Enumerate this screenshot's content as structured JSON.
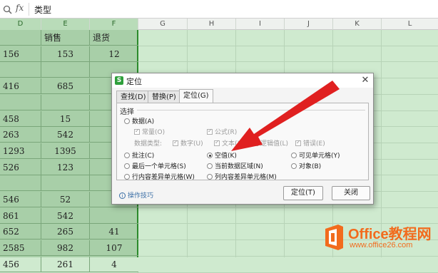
{
  "formula_bar": {
    "fx": "fx",
    "value": "类型"
  },
  "columns": [
    "D",
    "E",
    "F",
    "G",
    "H",
    "I",
    "J",
    "K",
    "L"
  ],
  "rows": [
    {
      "d": "",
      "e": "销售",
      "f": "退货",
      "header": true
    },
    {
      "d": "156",
      "e": "153",
      "f": "12"
    },
    {
      "d": "",
      "e": "",
      "f": ""
    },
    {
      "d": "416",
      "e": "685",
      "f": ""
    },
    {
      "d": "",
      "e": "",
      "f": ""
    },
    {
      "d": "458",
      "e": "15",
      "f": ""
    },
    {
      "d": "263",
      "e": "542",
      "f": ""
    },
    {
      "d": "1293",
      "e": "1395",
      "f": ""
    },
    {
      "d": "526",
      "e": "123",
      "f": ""
    },
    {
      "d": "",
      "e": "",
      "f": ""
    },
    {
      "d": "546",
      "e": "52",
      "f": ""
    },
    {
      "d": "861",
      "e": "542",
      "f": ""
    },
    {
      "d": "652",
      "e": "265",
      "f": "41"
    },
    {
      "d": "2585",
      "e": "982",
      "f": "107"
    },
    {
      "d": "456",
      "e": "261",
      "f": "4"
    }
  ],
  "dialog": {
    "title": "定位",
    "tabs": [
      "查找(D)",
      "替换(P)",
      "定位(G)"
    ],
    "group_label": "选择",
    "options": {
      "data": "数据(A)",
      "constants": "常量(O)",
      "formulas": "公式(R)",
      "data_type_label": "数据类型:",
      "numbers": "数字(U)",
      "text": "文本(X)",
      "logical": "逻辑值(L)",
      "errors": "错误(E)",
      "comments": "批注(C)",
      "blanks": "空值(K)",
      "visible_cells": "可见单元格(Y)",
      "last_cell": "最后一个单元格(S)",
      "current_region": "当前数据区域(N)",
      "objects": "对象(B)",
      "row_diff": "行内容差异单元格(W)",
      "col_diff": "列内容差异单元格(M)"
    },
    "tips": "操作技巧",
    "ok_button": "定位(T)",
    "close_button": "关闭"
  },
  "watermark": {
    "brand": "Office教程网",
    "url": "www.office26.com"
  },
  "colors": {
    "accent_green": "#2e9f3b",
    "arrow_red": "#e02020",
    "brand_orange": "#f26b1d"
  }
}
